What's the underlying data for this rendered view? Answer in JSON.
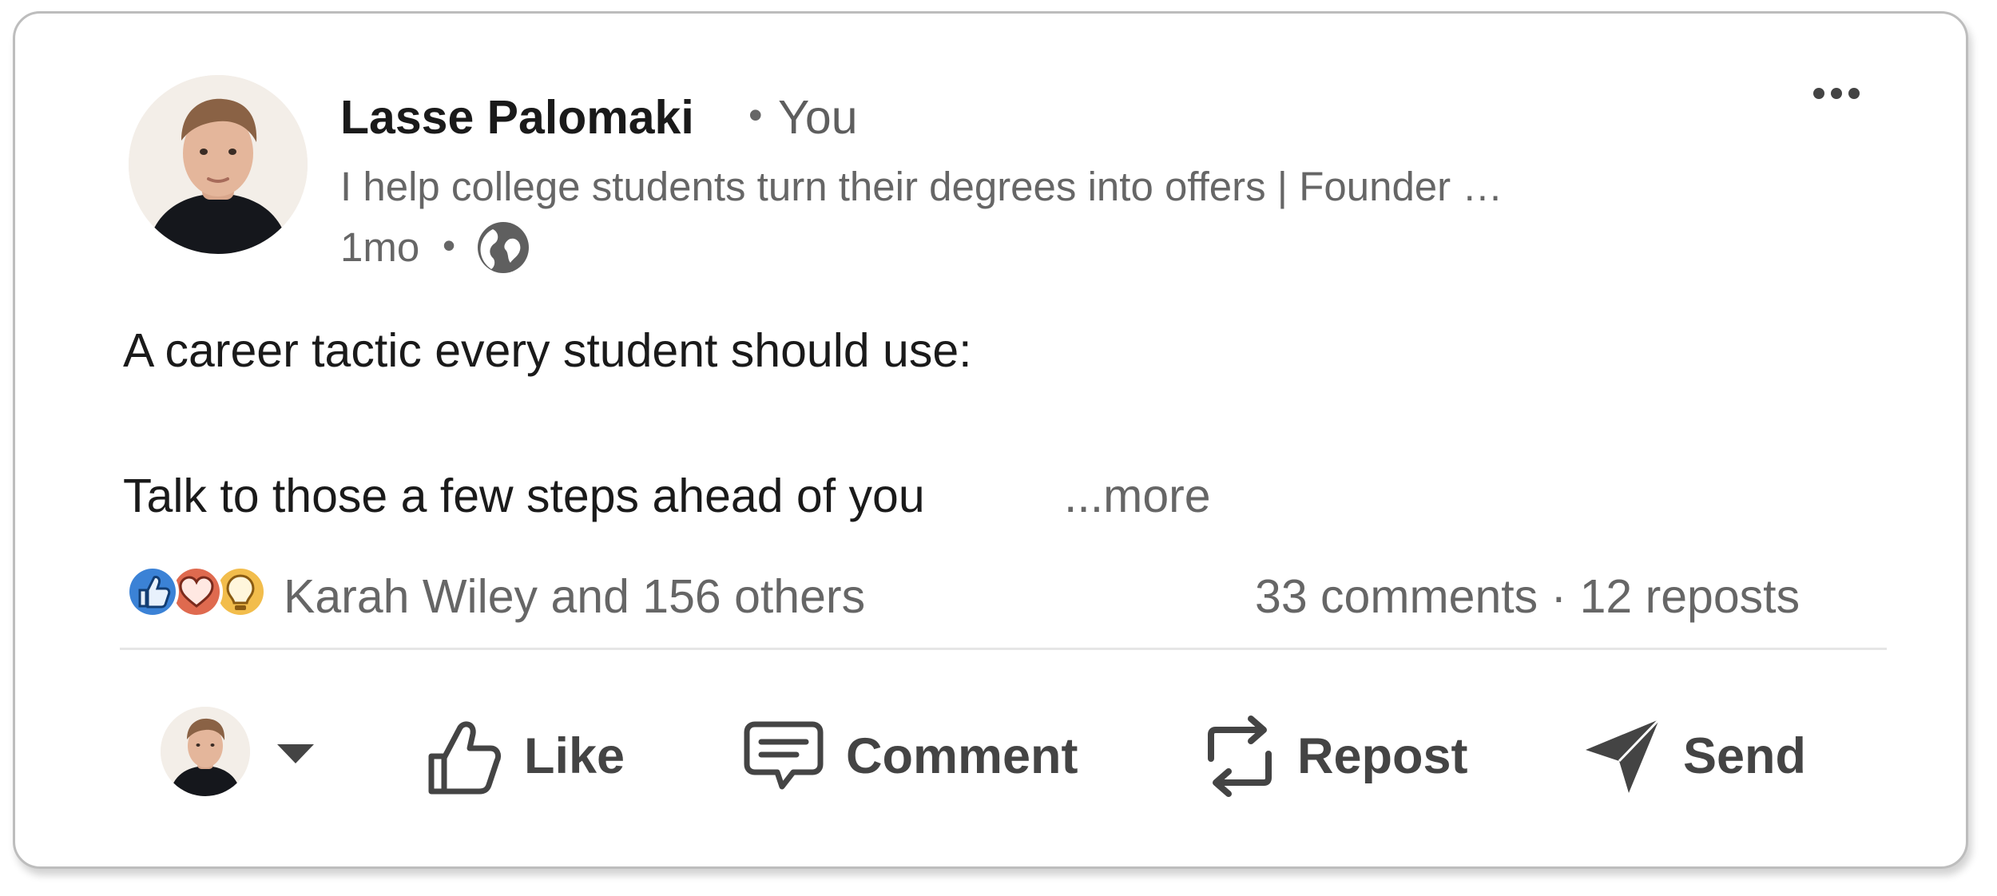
{
  "post": {
    "author": {
      "name": "Lasse Palomaki",
      "separator": "•",
      "relation": "You",
      "headline": "I help college students turn their degrees into offers | Founder …",
      "time": "1mo",
      "time_separator": "•",
      "visibility_icon": "globe-icon"
    },
    "menu_icon": "more-horizontal-icon",
    "body": {
      "line1": "A career tactic every student should use:",
      "line2": "Talk to those a few steps ahead of you",
      "see_more": "...more"
    },
    "social": {
      "reaction_icons": [
        "like-reaction-icon",
        "love-reaction-icon",
        "insightful-reaction-icon"
      ],
      "reactions_text": "Karah Wiley and 156 others",
      "stats_text": "33 comments · 12 reposts"
    },
    "actions": {
      "like": "Like",
      "comment": "Comment",
      "repost": "Repost",
      "send": "Send"
    },
    "colors": {
      "like": "#3b82d6",
      "love": "#df6a4f",
      "insightful": "#f2bd4c",
      "text_primary": "#1a1a1a",
      "text_secondary": "#666666",
      "action_gray": "#444444"
    }
  }
}
